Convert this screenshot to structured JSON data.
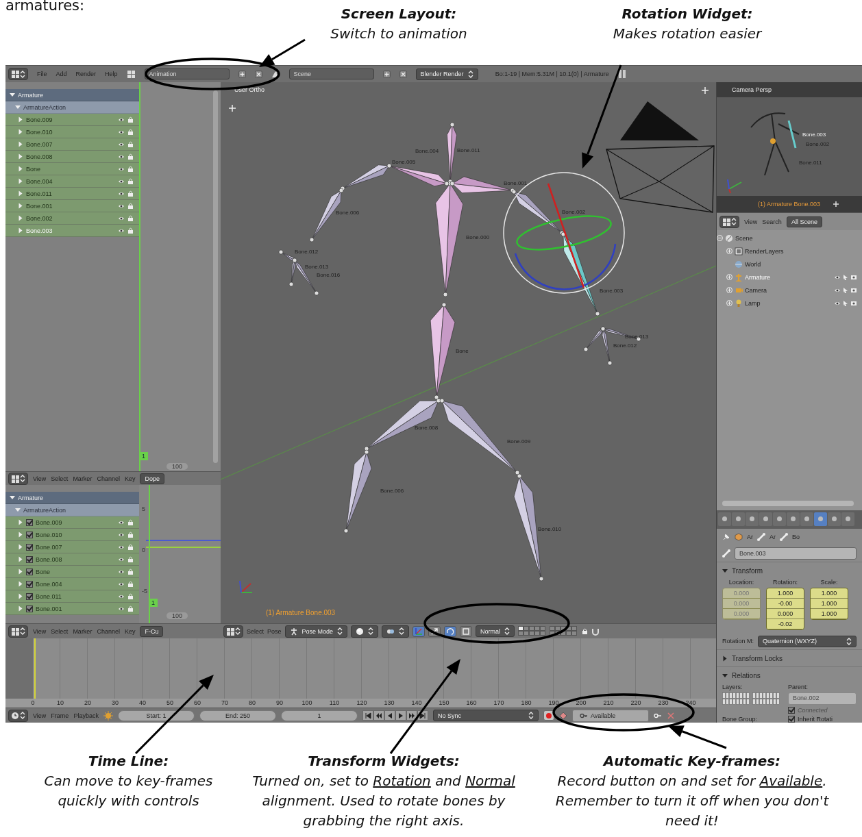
{
  "intro": {
    "text": "armatures:"
  },
  "annotations": {
    "top": [
      {
        "title": "Screen Layout:",
        "body": [
          {
            "text": "Switch to animation",
            "underline": false
          }
        ]
      },
      {
        "title": "Rotation Widget:",
        "body": [
          {
            "text": "Makes rotation easier",
            "underline": false
          }
        ]
      }
    ],
    "bottom": [
      {
        "title": "Time Line:",
        "body": [
          {
            "text": "Can move to key-frames quickly with controls",
            "underline": false
          }
        ]
      },
      {
        "title": "Transform Widgets:",
        "body": [
          {
            "text": "Turned on, set to ",
            "underline": false
          },
          {
            "text": "Rotation",
            "underline": true
          },
          {
            "text": " and ",
            "underline": false
          },
          {
            "text": "Normal",
            "underline": true
          },
          {
            "text": " alignment. Used to rotate bones by grabbing the right axis.",
            "underline": false
          }
        ]
      },
      {
        "title": "Automatic Key-frames:",
        "body": [
          {
            "text": "Record button on and set for ",
            "underline": false
          },
          {
            "text": "Available",
            "underline": true
          },
          {
            "text": ". Remember to turn it off when you don't need it!",
            "underline": false
          }
        ]
      }
    ]
  },
  "top_bar": {
    "menus": [
      "File",
      "Add",
      "Render",
      "Help"
    ],
    "screen_layout": "Animation",
    "scene": "Scene",
    "render_engine": "Blender Render",
    "stats": "Bo:1-19 | Mem:5.31M | 10.1(0) | Armature"
  },
  "dope_sheet": {
    "channels": [
      {
        "label": "Armature",
        "kind": "object",
        "expanded": true,
        "selected": false
      },
      {
        "label": "ArmatureAction",
        "kind": "action",
        "expanded": true,
        "selected": false
      },
      {
        "label": "Bone.009",
        "kind": "bone",
        "expanded": false,
        "selected": false
      },
      {
        "label": "Bone.010",
        "kind": "bone",
        "expanded": false,
        "selected": false
      },
      {
        "label": "Bone.007",
        "kind": "bone",
        "expanded": false,
        "selected": false
      },
      {
        "label": "Bone.008",
        "kind": "bone",
        "expanded": false,
        "selected": false
      },
      {
        "label": "Bone",
        "kind": "bone",
        "expanded": false,
        "selected": false
      },
      {
        "label": "Bone.004",
        "kind": "bone",
        "expanded": false,
        "selected": false
      },
      {
        "label": "Bone.011",
        "kind": "bone",
        "expanded": false,
        "selected": false
      },
      {
        "label": "Bone.001",
        "kind": "bone",
        "expanded": false,
        "selected": false
      },
      {
        "label": "Bone.002",
        "kind": "bone",
        "expanded": false,
        "selected": false
      },
      {
        "label": "Bone.003",
        "kind": "bone",
        "expanded": false,
        "selected": true
      }
    ],
    "current_frame": "1",
    "scroll_readout": "100",
    "header": {
      "menus": [
        "View",
        "Select",
        "Marker",
        "Channel",
        "Key"
      ],
      "mode": "Dope"
    }
  },
  "graph_editor": {
    "channels": [
      {
        "label": "Armature",
        "kind": "object",
        "expanded": true,
        "selected": false
      },
      {
        "label": "ArmatureAction",
        "kind": "action",
        "expanded": true,
        "selected": false
      },
      {
        "label": "Bone.009",
        "kind": "bone",
        "expanded": false,
        "selected": false,
        "checked": true
      },
      {
        "label": "Bone.010",
        "kind": "bone",
        "expanded": false,
        "selected": false,
        "checked": true
      },
      {
        "label": "Bone.007",
        "kind": "bone",
        "expanded": false,
        "selected": false,
        "checked": true
      },
      {
        "label": "Bone.008",
        "kind": "bone",
        "expanded": false,
        "selected": false,
        "checked": true
      },
      {
        "label": "Bone",
        "kind": "bone",
        "expanded": false,
        "selected": false,
        "checked": true
      },
      {
        "label": "Bone.004",
        "kind": "bone",
        "expanded": false,
        "selected": false,
        "checked": true
      },
      {
        "label": "Bone.011",
        "kind": "bone",
        "expanded": false,
        "selected": false,
        "checked": true
      },
      {
        "label": "Bone.001",
        "kind": "bone",
        "expanded": false,
        "selected": false,
        "checked": true
      }
    ],
    "y_ticks": [
      "5",
      "0",
      "-5"
    ],
    "current_frame": "1",
    "scroll_readout": "100",
    "header": {
      "menus": [
        "View",
        "Select",
        "Marker",
        "Channel",
        "Key"
      ],
      "mode": "F-Cu"
    }
  },
  "viewport": {
    "view_name": "User Ortho",
    "active_label": "(1) Armature Bone.003",
    "bone_labels": [
      "Bone.011",
      "Bone.005",
      "Bone.004",
      "Bone.001",
      "Bone.006",
      "Bone.002",
      "Bone.000",
      "Bone.012",
      "Bone.013",
      "Bone.016",
      "Bone.003",
      "Bone.013",
      "Bone.012",
      "Bone",
      "Bone.008",
      "Bone.009",
      "Bone.006",
      "Bone.010"
    ],
    "header": {
      "menus": [
        "Select",
        "Pose"
      ],
      "mode": "Pose Mode",
      "manipulator_on": true,
      "manipulators": [
        {
          "kind": "translate",
          "selected": false
        },
        {
          "kind": "rotate",
          "selected": true
        },
        {
          "kind": "scale",
          "selected": false
        }
      ],
      "orientation": "Normal"
    }
  },
  "timeline": {
    "ticks": [
      "0",
      "10",
      "20",
      "30",
      "40",
      "50",
      "60",
      "70",
      "80",
      "90",
      "100",
      "110",
      "120",
      "130",
      "140",
      "150",
      "160",
      "170",
      "180",
      "190",
      "200",
      "210",
      "220",
      "230",
      "240"
    ],
    "menus": [
      "View",
      "Frame",
      "Playback"
    ],
    "start": "Start: 1",
    "end": "End: 250",
    "frame": "1",
    "sync": "No Sync",
    "record": true,
    "keying_set": "Available"
  },
  "camera_view": {
    "title": "Camera Persp",
    "bone_labels": [
      "Bone.003",
      "Bone.002",
      "Bone.011"
    ],
    "active_label": "(1) Armature Bone.003"
  },
  "outliner": {
    "menus": [
      "View",
      "Search"
    ],
    "display_mode": "All Scene",
    "tree": [
      {
        "label": "Scene",
        "kind": "scene",
        "expanded": true,
        "selected": false,
        "children": [
          {
            "label": "RenderLayers",
            "kind": "render_layers",
            "expanded": false,
            "selected": false
          },
          {
            "label": "World",
            "kind": "world",
            "selected": false
          },
          {
            "label": "Armature",
            "kind": "armature",
            "expanded": false,
            "selected": true
          },
          {
            "label": "Camera",
            "kind": "camera",
            "expanded": false,
            "selected": false
          },
          {
            "label": "Lamp",
            "kind": "lamp",
            "expanded": false,
            "selected": false
          }
        ]
      }
    ]
  },
  "properties": {
    "tabs": [
      {
        "selected": false
      },
      {
        "selected": false
      },
      {
        "selected": false
      },
      {
        "selected": false
      },
      {
        "selected": false
      },
      {
        "selected": false
      },
      {
        "selected": false
      },
      {
        "selected": true
      },
      {
        "selected": false
      },
      {
        "selected": false
      }
    ],
    "breadcrumbs": [
      "Ar",
      "Ar",
      "Bo"
    ],
    "bone_name": "Bone.003",
    "transform": {
      "title": "Transform",
      "expanded": true,
      "columns": [
        {
          "label": "Location:",
          "disabled": true,
          "values": [
            "0.000",
            "0.000",
            "0.000"
          ]
        },
        {
          "label": "Rotation:",
          "disabled": false,
          "values": [
            "1.000",
            "-0.00",
            "0.000",
            "-0.02"
          ]
        },
        {
          "label": "Scale:",
          "disabled": false,
          "values": [
            "1.000",
            "1.000",
            "1.000"
          ]
        }
      ],
      "rotation_mode_label": "Rotation M:",
      "rotation_mode": "Quaternion (WXYZ)"
    },
    "transform_locks": {
      "title": "Transform Locks",
      "expanded": false
    },
    "relations": {
      "title": "Relations",
      "expanded": true,
      "layers_label": "Layers:",
      "parent_label": "Parent:",
      "parent": "Bone.002",
      "connected": {
        "label": "Connected",
        "checked": true,
        "disabled": true
      },
      "bone_group_label": "Bone Group:",
      "inherit_rotation": {
        "label": "Inherit Rotati",
        "checked": true,
        "disabled": false
      }
    }
  }
}
